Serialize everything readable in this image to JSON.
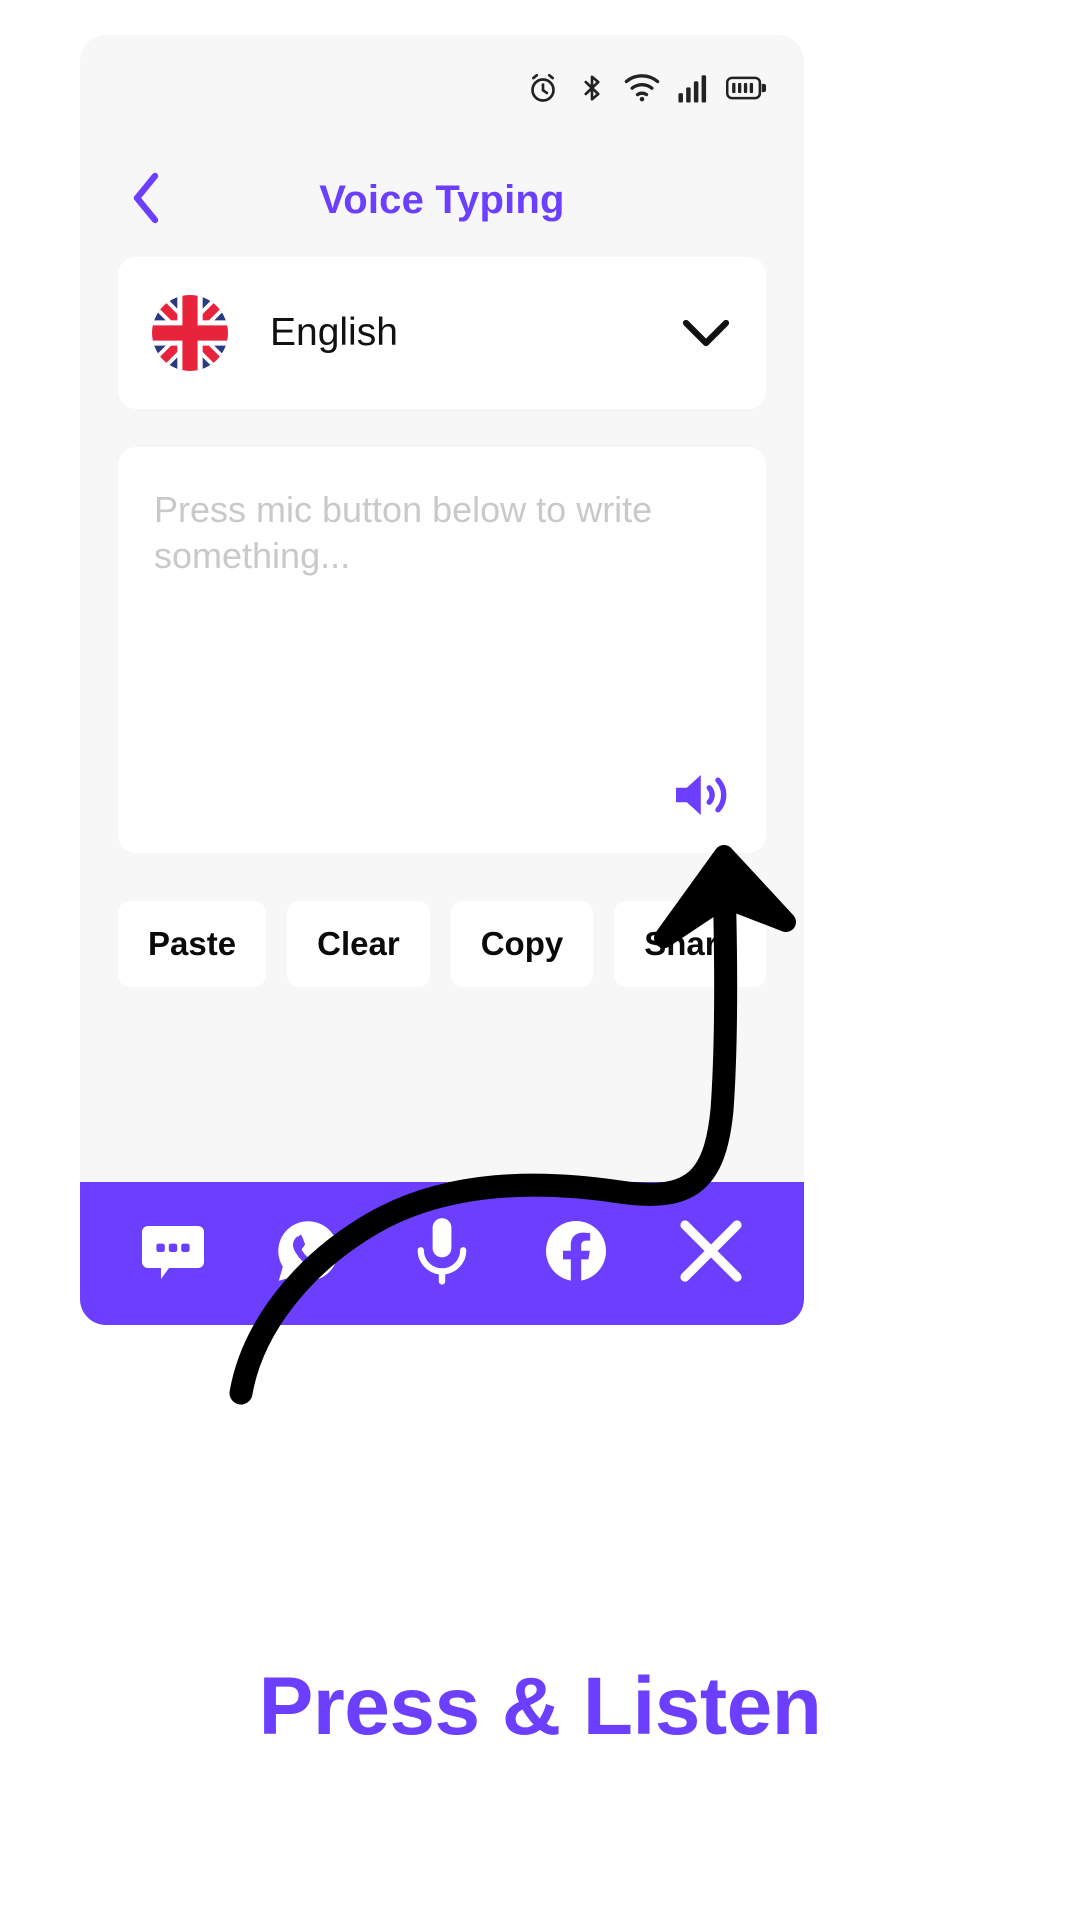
{
  "statusbar": {
    "icons": [
      {
        "name": "alarm-clock-icon"
      },
      {
        "name": "bluetooth-icon"
      },
      {
        "name": "wifi-icon"
      },
      {
        "name": "cellular-signal-icon"
      },
      {
        "name": "battery-icon"
      }
    ]
  },
  "header": {
    "title": "Voice Typing",
    "back_icon": "chevron-left-icon",
    "title_color": "#6B3FFD"
  },
  "language_selector": {
    "flag": "united-kingdom-flag",
    "value": "English",
    "chevron_icon": "chevron-down-icon"
  },
  "text_area": {
    "placeholder": "Press mic button below to write something...",
    "value": "",
    "speaker_icon": "speaker-volume-icon",
    "speaker_color": "#6B3FFD"
  },
  "actions": {
    "buttons": [
      {
        "label": "Paste",
        "name": "paste-button"
      },
      {
        "label": "Clear",
        "name": "clear-button"
      },
      {
        "label": "Copy",
        "name": "copy-button"
      },
      {
        "label": "Share",
        "name": "share-button"
      }
    ]
  },
  "bottom_nav": {
    "background": "#6B3FFD",
    "items": [
      {
        "name": "sms-message-icon",
        "label": "SMS"
      },
      {
        "name": "whatsapp-icon",
        "label": "WhatsApp"
      },
      {
        "name": "microphone-icon",
        "label": "Microphone"
      },
      {
        "name": "facebook-icon",
        "label": "Facebook"
      },
      {
        "name": "x-twitter-icon",
        "label": "X"
      }
    ]
  },
  "annotation": {
    "caption": "Press & Listen",
    "caption_color": "#6B3FFD",
    "arrow_color": "#000000",
    "arrow_points_to": "speaker-volume-icon"
  }
}
